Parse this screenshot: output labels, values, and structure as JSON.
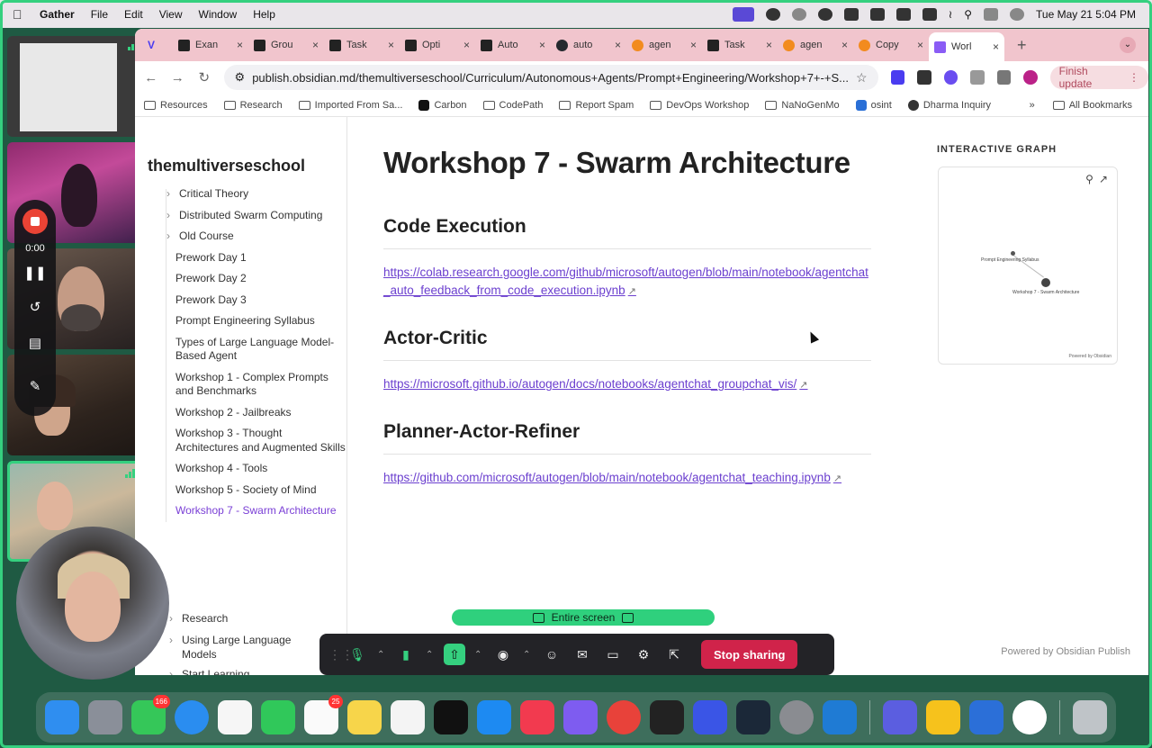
{
  "menubar": {
    "app_name": "Gather",
    "menus": [
      "File",
      "Edit",
      "View",
      "Window",
      "Help"
    ],
    "clock": "Tue May 21  5:04 PM"
  },
  "browser": {
    "tabs": [
      {
        "label": "Exan",
        "icon": "autogen-icon"
      },
      {
        "label": "Grou",
        "icon": "autogen-icon"
      },
      {
        "label": "Task",
        "icon": "autogen-icon"
      },
      {
        "label": "Opti",
        "icon": "autogen-icon"
      },
      {
        "label": "Auto",
        "icon": "autogen-icon"
      },
      {
        "label": "auto",
        "icon": "github-icon"
      },
      {
        "label": "agen",
        "icon": "orange-icon"
      },
      {
        "label": "Task",
        "icon": "autogen-icon"
      },
      {
        "label": "agen",
        "icon": "orange-icon"
      },
      {
        "label": "Copy",
        "icon": "orange-icon"
      },
      {
        "label": "Worl",
        "icon": "obsidian-icon",
        "active": true
      }
    ],
    "url": "publish.obsidian.md/themultiverseschool/Curriculum/Autonomous+Agents/Prompt+Engineering/Workshop+7+-+S...",
    "finish_update": "Finish update",
    "bookmarks": [
      "Resources",
      "Research",
      "Imported From Sa...",
      "Carbon",
      "CodePath",
      "Report Spam",
      "DevOps Workshop",
      "NaNoGenMo",
      "osint",
      "Dharma Inquiry"
    ],
    "all_bookmarks": "All Bookmarks"
  },
  "site": {
    "title": "themultiverseschool",
    "nav_partial_top": "Critical Theory",
    "nav_groups": [
      "Distributed Swarm Computing",
      "Old Course"
    ],
    "nav_items": [
      "Prework Day 1",
      "Prework Day 2",
      "Prework Day 3",
      "Prompt Engineering Syllabus",
      "Types of Large Language Model-Based Agent",
      "Workshop 1 - Complex Prompts and Benchmarks",
      "Workshop 2 - Jailbreaks",
      "Workshop 3 - Thought Architectures and Augmented Skills",
      "Workshop 4 - Tools",
      "Workshop 5 - Society of Mind",
      "Workshop 7 - Swarm Architecture"
    ],
    "outer_items": [
      "Research",
      "Using Large Language Models",
      "Start Learning"
    ]
  },
  "article": {
    "title": "Workshop 7 - Swarm Architecture",
    "sections": [
      {
        "heading": "Code Execution",
        "link": "https://colab.research.google.com/github/microsoft/autogen/blob/main/notebook/agentchat_auto_feedback_from_code_execution.ipynb"
      },
      {
        "heading": "Actor-Critic",
        "link": "https://microsoft.github.io/autogen/docs/notebooks/agentchat_groupchat_vis/"
      },
      {
        "heading": "Planner-Actor-Refiner",
        "link": "https://github.com/microsoft/autogen/blob/main/notebook/agentchat_teaching.ipynb"
      }
    ]
  },
  "graph": {
    "label": "INTERACTIVE GRAPH",
    "node_a": "Prompt Engineering Syllabus",
    "node_b": "Workshop 7 - Swarm Architecture",
    "powered": "Powered by Obsidian"
  },
  "footer": {
    "powered_publish": "Powered by Obsidian Publish"
  },
  "gather": {
    "timer": "0:00"
  },
  "sharing": {
    "pill": "Entire screen",
    "stop": "Stop sharing"
  },
  "dock": {
    "apps": [
      "Finder",
      "Launchpad",
      "Messages",
      "Safari",
      "Photos",
      "FaceTime",
      "Reminders",
      "Notes",
      "Freeform",
      "TV",
      "App Store",
      "News",
      "Obsidian",
      "Chrome",
      "Terminal",
      "Gather",
      "Steam",
      "System Settings",
      "VS Code",
      "Linear",
      "Bee",
      "Screen",
      "ChatGPT",
      "Trash"
    ],
    "badges": {
      "Messages": "166",
      "Reminders": "25"
    }
  }
}
